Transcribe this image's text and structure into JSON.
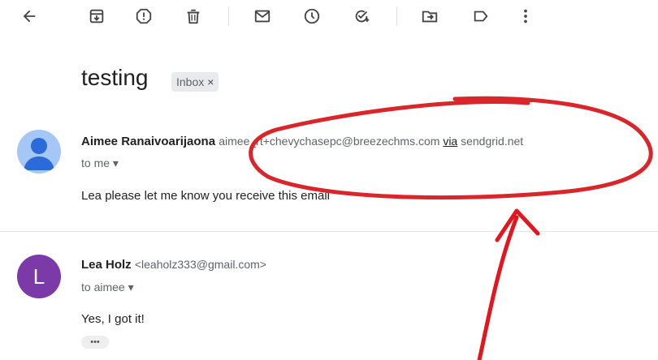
{
  "toolbar": {
    "icons": [
      "back-arrow-icon",
      "archive-icon",
      "report-spam-icon",
      "delete-icon",
      "mark-unread-icon",
      "snooze-icon",
      "add-task-icon",
      "move-to-icon",
      "label-icon",
      "more-vert-icon"
    ]
  },
  "subject": "testing",
  "label_chip": "Inbox",
  "chip_close": "×",
  "messages": [
    {
      "sender_name": "Aimee Ranaivoarijaona",
      "sender_email_prefix": "aimee_rt+chevychasepc@breezechms.com",
      "via_word": "via",
      "via_domain": "sendgrid.net",
      "to": "to me",
      "body": "Lea   please let me know you receive this email"
    },
    {
      "avatar_letter": "L",
      "sender_name": "Lea Holz",
      "sender_email": "<leaholz333@gmail.com>",
      "to": "to aimee",
      "body": "Yes, I got it!",
      "more": "•••"
    }
  ],
  "colors": {
    "annotation": "#d8262b",
    "avatar1": "#a5c7f5",
    "avatar2": "#7b3aa8",
    "chip_bg": "#e8eaed"
  }
}
